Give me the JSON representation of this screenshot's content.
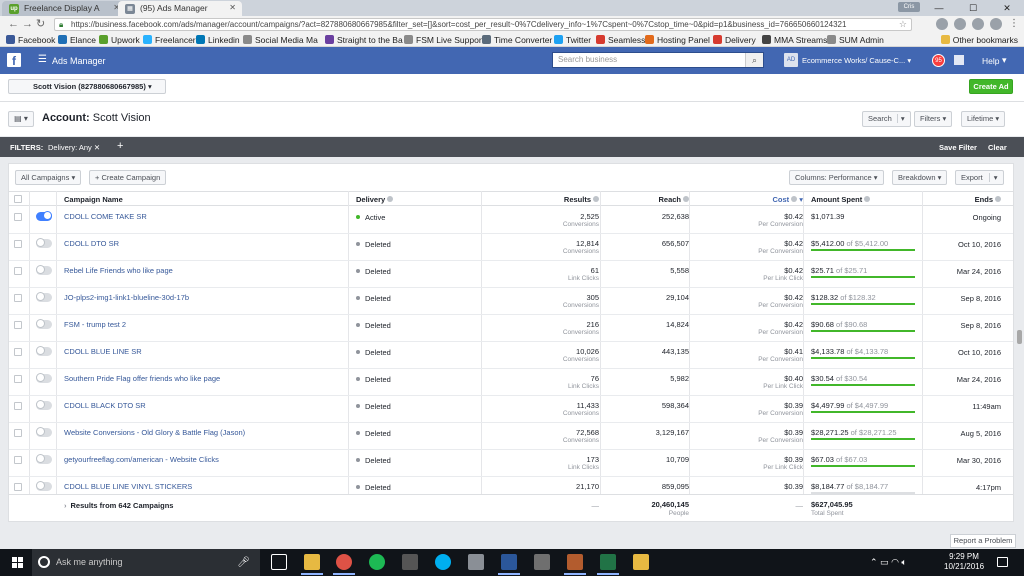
{
  "browser": {
    "tabs": [
      {
        "label": "Freelance Display A",
        "active": false
      },
      {
        "label": "(95) Ads Manager",
        "active": true
      }
    ],
    "url": "https://business.facebook.com/ads/manager/account/campaigns/?act=827880680667985&filter_set=[]&sort=cost_per_result~0%7Cdelivery_info~1%7Cspent~0%7Cstop_time~0&pid=p1&business_id=766650660124321",
    "bookmarks": [
      "Facebook",
      "Elance",
      "Upwork",
      "Freelancer",
      "Linkedin",
      "Social Media Ma",
      "Straight to the Ba",
      "FSM Live Support",
      "Time Converter",
      "Twitter",
      "Seamless",
      "Hosting Panel",
      "Delivery",
      "MMA Streams",
      "SUM Admin"
    ],
    "other_bookmarks": "Other bookmarks",
    "user_chip": "Cris"
  },
  "header": {
    "title": "Ads Manager",
    "search_placeholder": "Search business",
    "business": "Ecommerce Works/ Cause-C...",
    "business_avatar": "AD",
    "notifications": "95",
    "help": "Help"
  },
  "account": {
    "selector": "Scott Vision (827880680667985)",
    "create_ad": "Create Ad",
    "title_prefix": "Account:",
    "title_name": "Scott Vision",
    "search": "Search",
    "filters": "Filters",
    "lifetime": "Lifetime"
  },
  "filterbar": {
    "label": "FILTERS:",
    "chip": "Delivery: Any",
    "save": "Save Filter",
    "clear": "Clear"
  },
  "tools": {
    "all_campaigns": "All Campaigns",
    "create_campaign": "Create Campaign",
    "columns": "Columns: Performance",
    "breakdown": "Breakdown",
    "export": "Export"
  },
  "columns": {
    "name": "Campaign Name",
    "delivery": "Delivery",
    "results": "Results",
    "reach": "Reach",
    "cost": "Cost",
    "spent": "Amount Spent",
    "ends": "Ends"
  },
  "rows": [
    {
      "name": "CDOLL COME TAKE SR",
      "on": true,
      "delivery": "Active",
      "status": "active",
      "results": "2,525",
      "results_type": "Conversions",
      "reach": "252,638",
      "cost": "$0.42",
      "cost_type": "Per Conversion",
      "spent": "$1,071.39",
      "spent_of": "",
      "progress": 0,
      "ends": "Ongoing"
    },
    {
      "name": "CDOLL DTO SR",
      "on": false,
      "delivery": "Deleted",
      "status": "deleted",
      "results": "12,814",
      "results_type": "Conversions",
      "reach": "656,507",
      "cost": "$0.42",
      "cost_type": "Per Conversion",
      "spent": "$5,412.00",
      "spent_of": "of $5,412.00",
      "progress": 1,
      "ends": "Oct 10, 2016"
    },
    {
      "name": "Rebel Life Friends who like page",
      "on": false,
      "delivery": "Deleted",
      "status": "deleted",
      "results": "61",
      "results_type": "Link Clicks",
      "reach": "5,558",
      "cost": "$0.42",
      "cost_type": "Per Link Click",
      "spent": "$25.71",
      "spent_of": "of $25.71",
      "progress": 1,
      "ends": "Mar 24, 2016"
    },
    {
      "name": "JO-plps2-img1-link1-blueline-30d-17b",
      "on": false,
      "delivery": "Deleted",
      "status": "deleted",
      "results": "305",
      "results_type": "Conversions",
      "reach": "29,104",
      "cost": "$0.42",
      "cost_type": "Per Conversion",
      "spent": "$128.32",
      "spent_of": "of $128.32",
      "progress": 1,
      "ends": "Sep 8, 2016"
    },
    {
      "name": "FSM - trump test 2",
      "on": false,
      "delivery": "Deleted",
      "status": "deleted",
      "results": "216",
      "results_type": "Conversions",
      "reach": "14,824",
      "cost": "$0.42",
      "cost_type": "Per Conversion",
      "spent": "$90.68",
      "spent_of": "of $90.68",
      "progress": 1,
      "ends": "Sep 8, 2016"
    },
    {
      "name": "CDOLL BLUE LINE SR",
      "on": false,
      "delivery": "Deleted",
      "status": "deleted",
      "results": "10,026",
      "results_type": "Conversions",
      "reach": "443,135",
      "cost": "$0.41",
      "cost_type": "Per Conversion",
      "spent": "$4,133.78",
      "spent_of": "of $4,133.78",
      "progress": 1,
      "ends": "Oct 10, 2016"
    },
    {
      "name": "Southern Pride Flag offer friends who like page",
      "on": false,
      "delivery": "Deleted",
      "status": "deleted",
      "results": "76",
      "results_type": "Link Clicks",
      "reach": "5,982",
      "cost": "$0.40",
      "cost_type": "Per Link Click",
      "spent": "$30.54",
      "spent_of": "of $30.54",
      "progress": 1,
      "ends": "Mar 24, 2016"
    },
    {
      "name": "CDOLL BLACK DTO SR",
      "on": false,
      "delivery": "Deleted",
      "status": "deleted",
      "results": "11,433",
      "results_type": "Conversions",
      "reach": "598,364",
      "cost": "$0.39",
      "cost_type": "Per Conversion",
      "spent": "$4,497.99",
      "spent_of": "of $4,497.99",
      "progress": 1,
      "ends": "11:49am"
    },
    {
      "name": "Website Conversions - Old Glory & Battle Flag (Jason)",
      "on": false,
      "delivery": "Deleted",
      "status": "deleted",
      "results": "72,568",
      "results_type": "Conversions",
      "reach": "3,129,167",
      "cost": "$0.39",
      "cost_type": "Per Conversion",
      "spent": "$28,271.25",
      "spent_of": "of $28,271.25",
      "progress": 1,
      "ends": "Aug 5, 2016"
    },
    {
      "name": "getyourfreeflag.com/american - Website Clicks",
      "on": false,
      "delivery": "Deleted",
      "status": "deleted",
      "results": "173",
      "results_type": "Link Clicks",
      "reach": "10,709",
      "cost": "$0.39",
      "cost_type": "Per Link Click",
      "spent": "$67.03",
      "spent_of": "of $67.03",
      "progress": 1,
      "ends": "Mar 30, 2016"
    },
    {
      "name": "CDOLL BLUE LINE VINYL STICKERS",
      "on": false,
      "delivery": "Deleted",
      "status": "deleted",
      "results": "21,170",
      "results_type": "",
      "reach": "859,095",
      "cost": "$0.39",
      "cost_type": "",
      "spent": "$8,184.77",
      "spent_of": "of $8,184.77",
      "progress": 0,
      "ends": "4:17pm"
    }
  ],
  "totals": {
    "label": "Results from 642 Campaigns",
    "results": "—",
    "reach": "20,460,145",
    "reach_type": "People",
    "cost": "—",
    "spent": "$627,045.95",
    "spent_type": "Total Spent"
  },
  "report_problem": "Report a Problem",
  "taskbar": {
    "search": "Ask me anything",
    "time": "9:29 PM",
    "date": "10/21/2016"
  }
}
